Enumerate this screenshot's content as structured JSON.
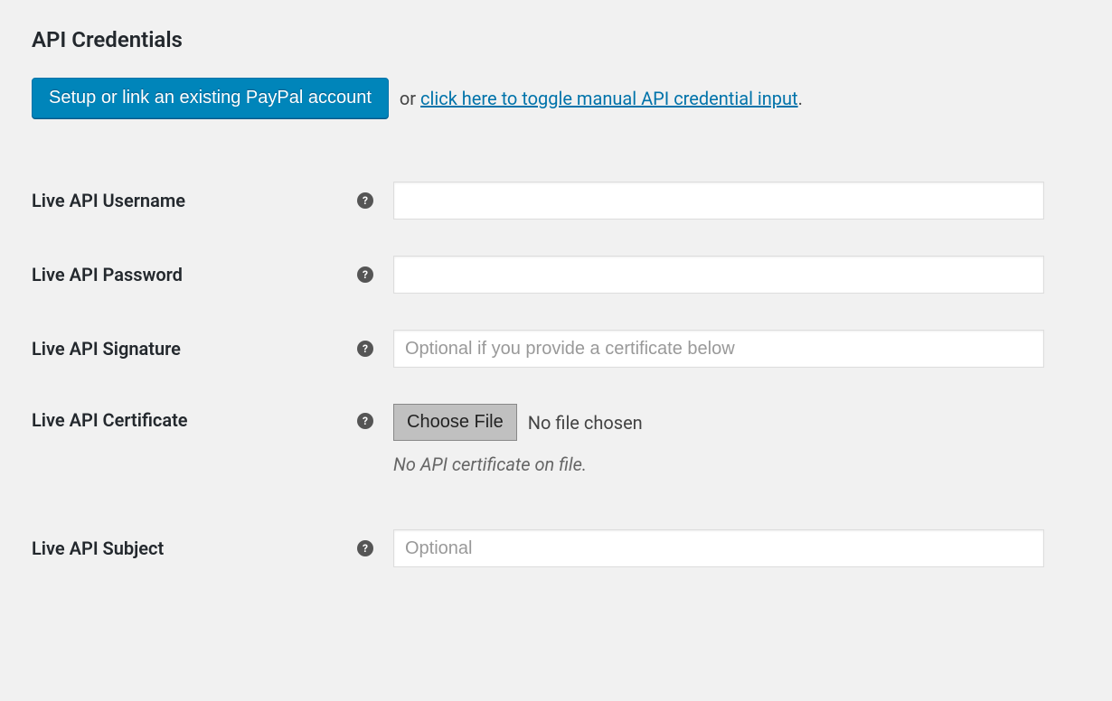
{
  "section": {
    "title": "API Credentials"
  },
  "setup": {
    "button_label": "Setup or link an existing PayPal account",
    "or_text": "  or ",
    "toggle_link_text": "click here to toggle manual API credential input",
    "period": "."
  },
  "fields": {
    "username": {
      "label": "Live API Username",
      "value": "",
      "help_glyph": "?"
    },
    "password": {
      "label": "Live API Password",
      "value": "",
      "help_glyph": "?"
    },
    "signature": {
      "label": "Live API Signature",
      "value": "",
      "placeholder": "Optional if you provide a certificate below",
      "help_glyph": "?"
    },
    "certificate": {
      "label": "Live API Certificate",
      "choose_button": "Choose File",
      "no_file_text": "No file chosen",
      "note": "No API certificate on file.",
      "help_glyph": "?"
    },
    "subject": {
      "label": "Live API Subject",
      "value": "",
      "placeholder": "Optional",
      "help_glyph": "?"
    }
  }
}
